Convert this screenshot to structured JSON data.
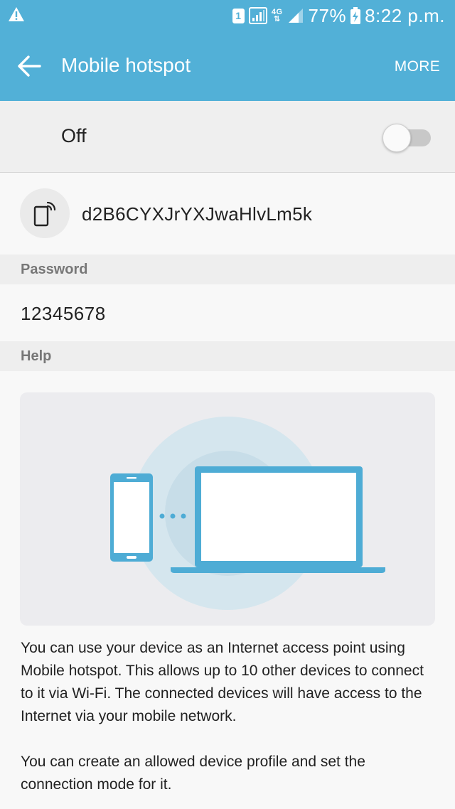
{
  "status_bar": {
    "battery": "77%",
    "time": "8:22 p.m.",
    "sim": "1",
    "network_type": "4G",
    "icons": [
      "warning-icon",
      "sim-icon",
      "signal-icon",
      "4g-icon",
      "signal-icon",
      "battery-charging-icon"
    ]
  },
  "app_bar": {
    "title": "Mobile hotspot",
    "more_label": "MORE",
    "back_icon": "arrow-left-icon"
  },
  "switch": {
    "label": "Off",
    "state": "off"
  },
  "network": {
    "name": "d2B6CYXJrYXJwaHlvLm5k",
    "icon": "hotspot-device-icon"
  },
  "password_section": {
    "header": "Password",
    "value": "12345678"
  },
  "help_section": {
    "header": "Help",
    "paragraph1": "You can use your device as an Internet access point using Mobile hotspot. This allows up to 10 other devices to connect to it via Wi-Fi. The connected devices will have access to the Internet via your mobile network.",
    "paragraph2": "You can create an allowed device profile and set the connection mode for it."
  },
  "colors": {
    "accent": "#52b0d7",
    "illustration_blue": "#4eacd5",
    "ring_light": "#d5e6ee"
  }
}
